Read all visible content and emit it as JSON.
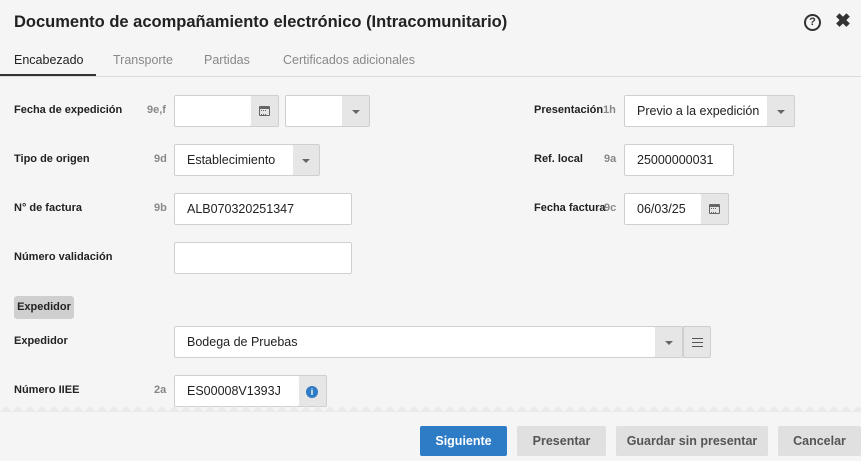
{
  "dialog": {
    "title": "Documento de acompañamiento electrónico (Intracomunitario)",
    "help_icon": "?",
    "close_icon": "✖"
  },
  "tabs": [
    {
      "label": "Encabezado",
      "active": true
    },
    {
      "label": "Transporte",
      "active": false
    },
    {
      "label": "Partidas",
      "active": false
    },
    {
      "label": "Certificados adicionales",
      "active": false
    }
  ],
  "form": {
    "fecha_expedicion": {
      "label": "Fecha de expedición",
      "code": "9e,f",
      "date_value": "",
      "time_value": ""
    },
    "presentacion": {
      "label": "Presentación",
      "code": "1h",
      "value": "Previo a la expedición"
    },
    "tipo_origen": {
      "label": "Tipo de origen",
      "code": "9d",
      "value": "Establecimiento"
    },
    "ref_local": {
      "label": "Ref. local",
      "code": "9a",
      "value": "25000000031"
    },
    "num_factura": {
      "label": "N° de factura",
      "code": "9b",
      "value": "ALB070320251347"
    },
    "fecha_factura": {
      "label": "Fecha factura",
      "code": "9c",
      "value": "06/03/25"
    },
    "num_validacion": {
      "label": "Número validación",
      "value": ""
    },
    "section_expedidor": "Expedidor",
    "expedidor": {
      "label": "Expedidor",
      "value": "Bodega de Pruebas"
    },
    "num_iiee": {
      "label": "Número IIEE",
      "code": "2a",
      "value": "ES00008V1393J",
      "info_icon": "i"
    }
  },
  "footer": {
    "siguiente": "Siguiente",
    "presentar": "Presentar",
    "guardar": "Guardar sin presentar",
    "cancelar": "Cancelar"
  },
  "colors": {
    "primary": "#2e7bc6",
    "background": "#f5f5f5",
    "addon": "#e6e6e6"
  }
}
